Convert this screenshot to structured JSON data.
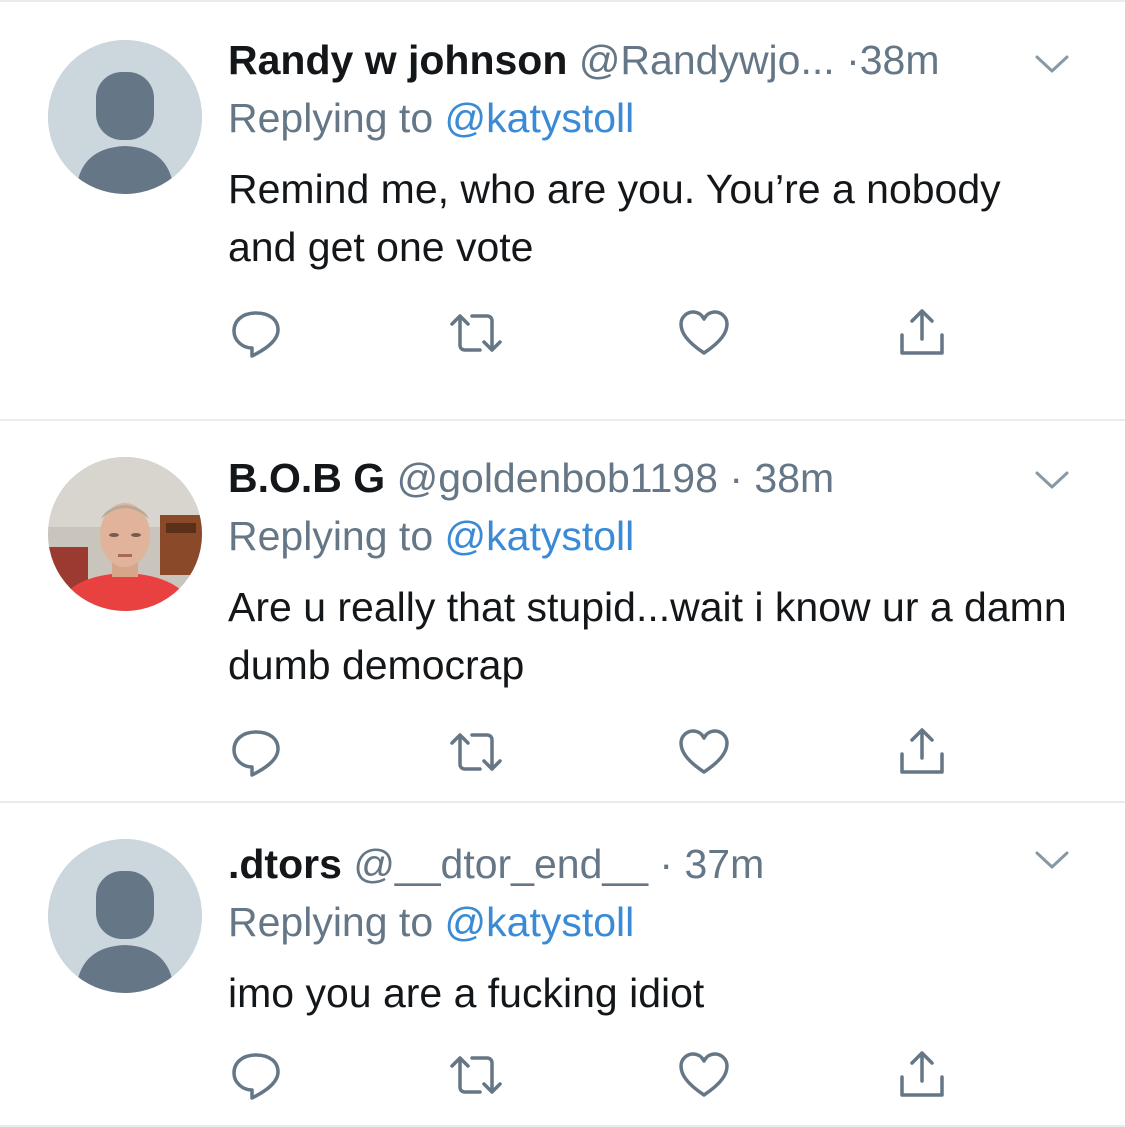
{
  "tweets": [
    {
      "display_name": "Randy w johnson",
      "handle": "@Randywjo...",
      "separator": "·",
      "time": "38m",
      "replying_prefix": "Replying to",
      "replying_to": "@katystoll",
      "text": "Remind me, who are you. You’re a nobody and get one vote",
      "avatar": "default-avatar"
    },
    {
      "display_name": "B.O.B G",
      "handle": "@goldenbob1198",
      "separator": "·",
      "time": "38m",
      "replying_prefix": "Replying to",
      "replying_to": "@katystoll",
      "text": "Are u really that stupid...wait i know ur a damn dumb democrap",
      "avatar": "photo-avatar"
    },
    {
      "display_name": ".dtors",
      "handle": "@__dtor_end__",
      "separator": "·",
      "time": "37m",
      "replying_prefix": "Replying to",
      "replying_to": "@katystoll",
      "text": "imo you are a fucking idiot",
      "avatar": "default-avatar"
    }
  ],
  "icons": {
    "reply": "reply-icon",
    "retweet": "retweet-icon",
    "like": "heart-icon",
    "share": "share-icon",
    "menu": "chevron-down-icon"
  },
  "colors": {
    "link": "#3a8ad6",
    "muted": "#657786",
    "divider": "#e6ecf0",
    "default_avatar_bg": "#ccd6dd",
    "default_avatar_figure": "#657786"
  }
}
